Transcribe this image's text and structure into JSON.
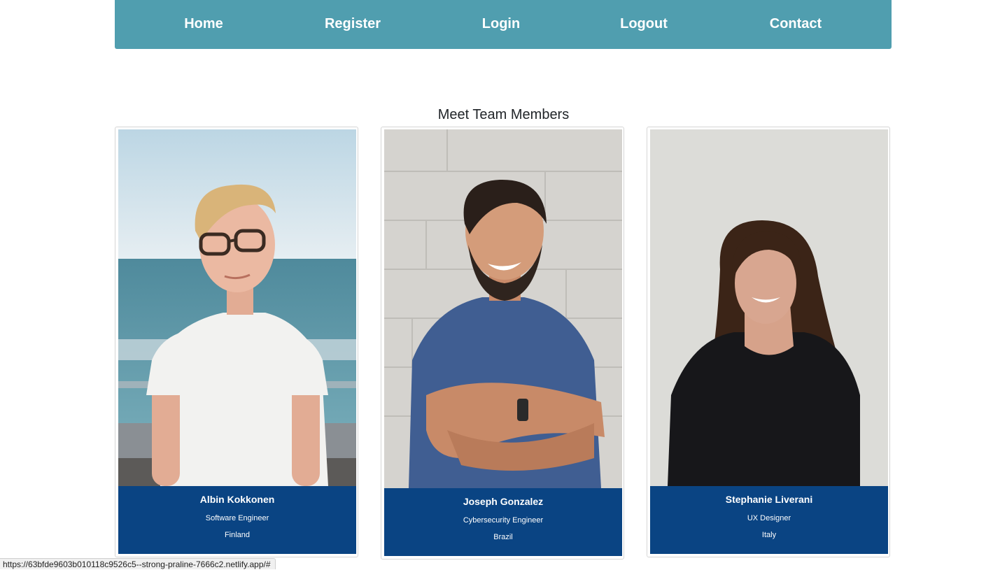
{
  "nav": {
    "items": [
      {
        "label": "Home"
      },
      {
        "label": "Register"
      },
      {
        "label": "Login"
      },
      {
        "label": "Logout"
      },
      {
        "label": "Contact"
      }
    ]
  },
  "main": {
    "title": "Meet Team Members",
    "members": [
      {
        "name": "Albin Kokkonen",
        "role": "Software Engineer",
        "country": "Finland"
      },
      {
        "name": "Joseph Gonzalez",
        "role": "Cybersecurity Engineer",
        "country": "Brazil"
      },
      {
        "name": "Stephanie Liverani",
        "role": "UX Designer",
        "country": "Italy"
      }
    ]
  },
  "status_bar": {
    "url": "https://63bfde9603b010118c9526c5--strong-praline-7666c2.netlify.app/#"
  },
  "colors": {
    "navbar": "#509eaf",
    "caption": "#0a4483"
  }
}
